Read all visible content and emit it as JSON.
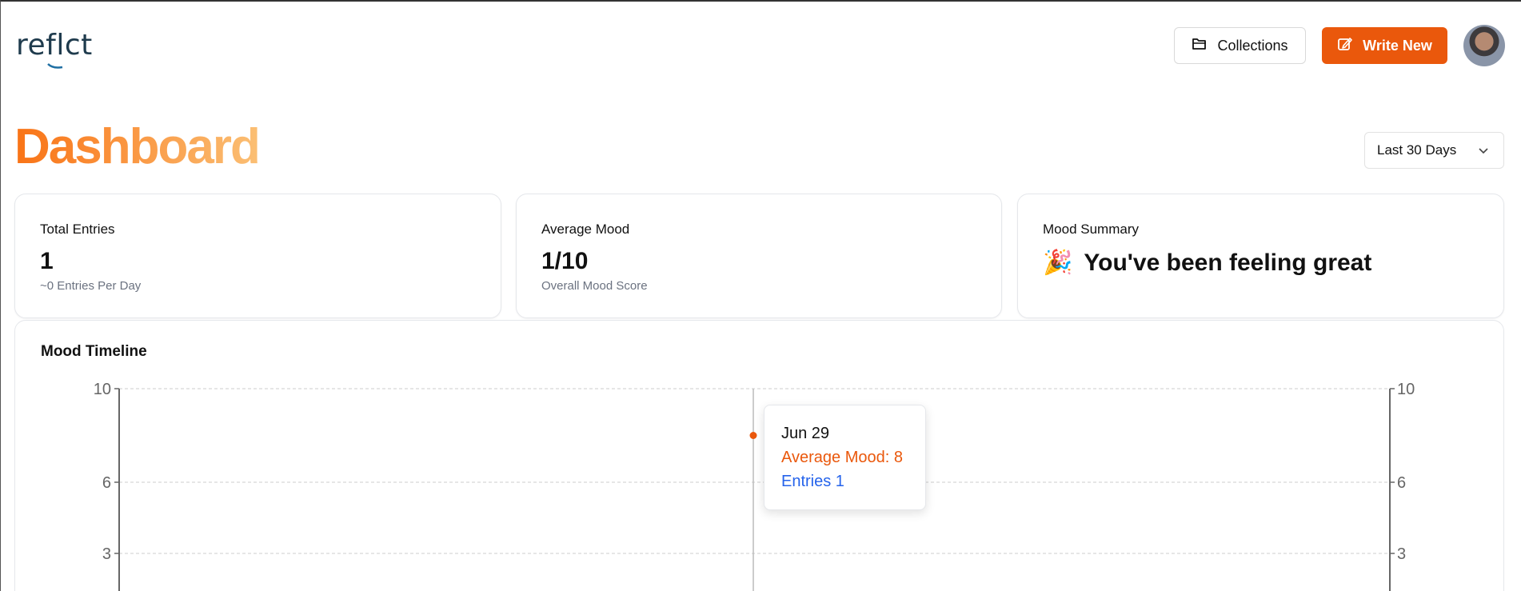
{
  "header": {
    "logo_text": "reflct",
    "collections_label": "Collections",
    "write_new_label": "Write New"
  },
  "page": {
    "title": "Dashboard",
    "range_selected": "Last 30 Days"
  },
  "stats": {
    "total_entries": {
      "label": "Total Entries",
      "value": "1",
      "sub": "~0 Entries Per Day"
    },
    "average_mood": {
      "label": "Average Mood",
      "value": "1/10",
      "sub": "Overall Mood Score"
    },
    "mood_summary": {
      "label": "Mood Summary",
      "emoji": "🎉",
      "text": "You've been feeling great"
    }
  },
  "timeline": {
    "title": "Mood Timeline",
    "tooltip": {
      "date": "Jun 29",
      "mood": "Average Mood: 8",
      "entries": "Entries 1"
    }
  },
  "colors": {
    "accent": "#ea580c",
    "entries": "#2563eb",
    "grid": "#cccccc"
  },
  "chart_data": {
    "type": "line",
    "x": [
      "Jun 29"
    ],
    "series": [
      {
        "name": "Average Mood",
        "values": [
          8
        ]
      },
      {
        "name": "Entries",
        "values": [
          1
        ]
      }
    ],
    "yticks_left": [
      "10",
      "6",
      "3"
    ],
    "yticks_right": [
      "10",
      "6",
      "3"
    ],
    "ylim": [
      0,
      10
    ],
    "grid": true
  }
}
